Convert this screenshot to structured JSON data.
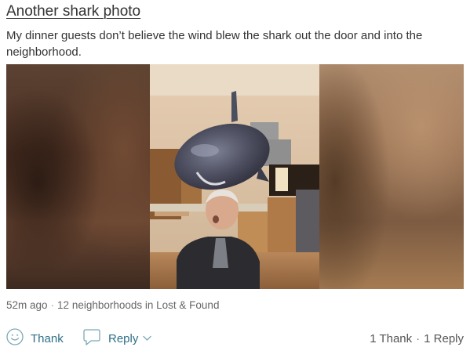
{
  "post": {
    "title": "Another shark photo",
    "body": "My dinner guests don’t believe the wind blew the shark out the door and into the neighborhood.",
    "time_ago": "52m ago",
    "separator": "·",
    "audience": "12 neighborhoods in Lost & Found"
  },
  "actions": {
    "thank_label": "Thank",
    "thank_icon": "smiley-icon",
    "reply_label": "Reply",
    "reply_icon": "speech-bubble-icon",
    "reply_dropdown_icon": "chevron-down-icon"
  },
  "summary": {
    "thanks": "1 Thank",
    "separator": "·",
    "replies": "1 Reply"
  },
  "colors": {
    "link": "#2f6f86",
    "text": "#333333",
    "muted": "#666666"
  }
}
